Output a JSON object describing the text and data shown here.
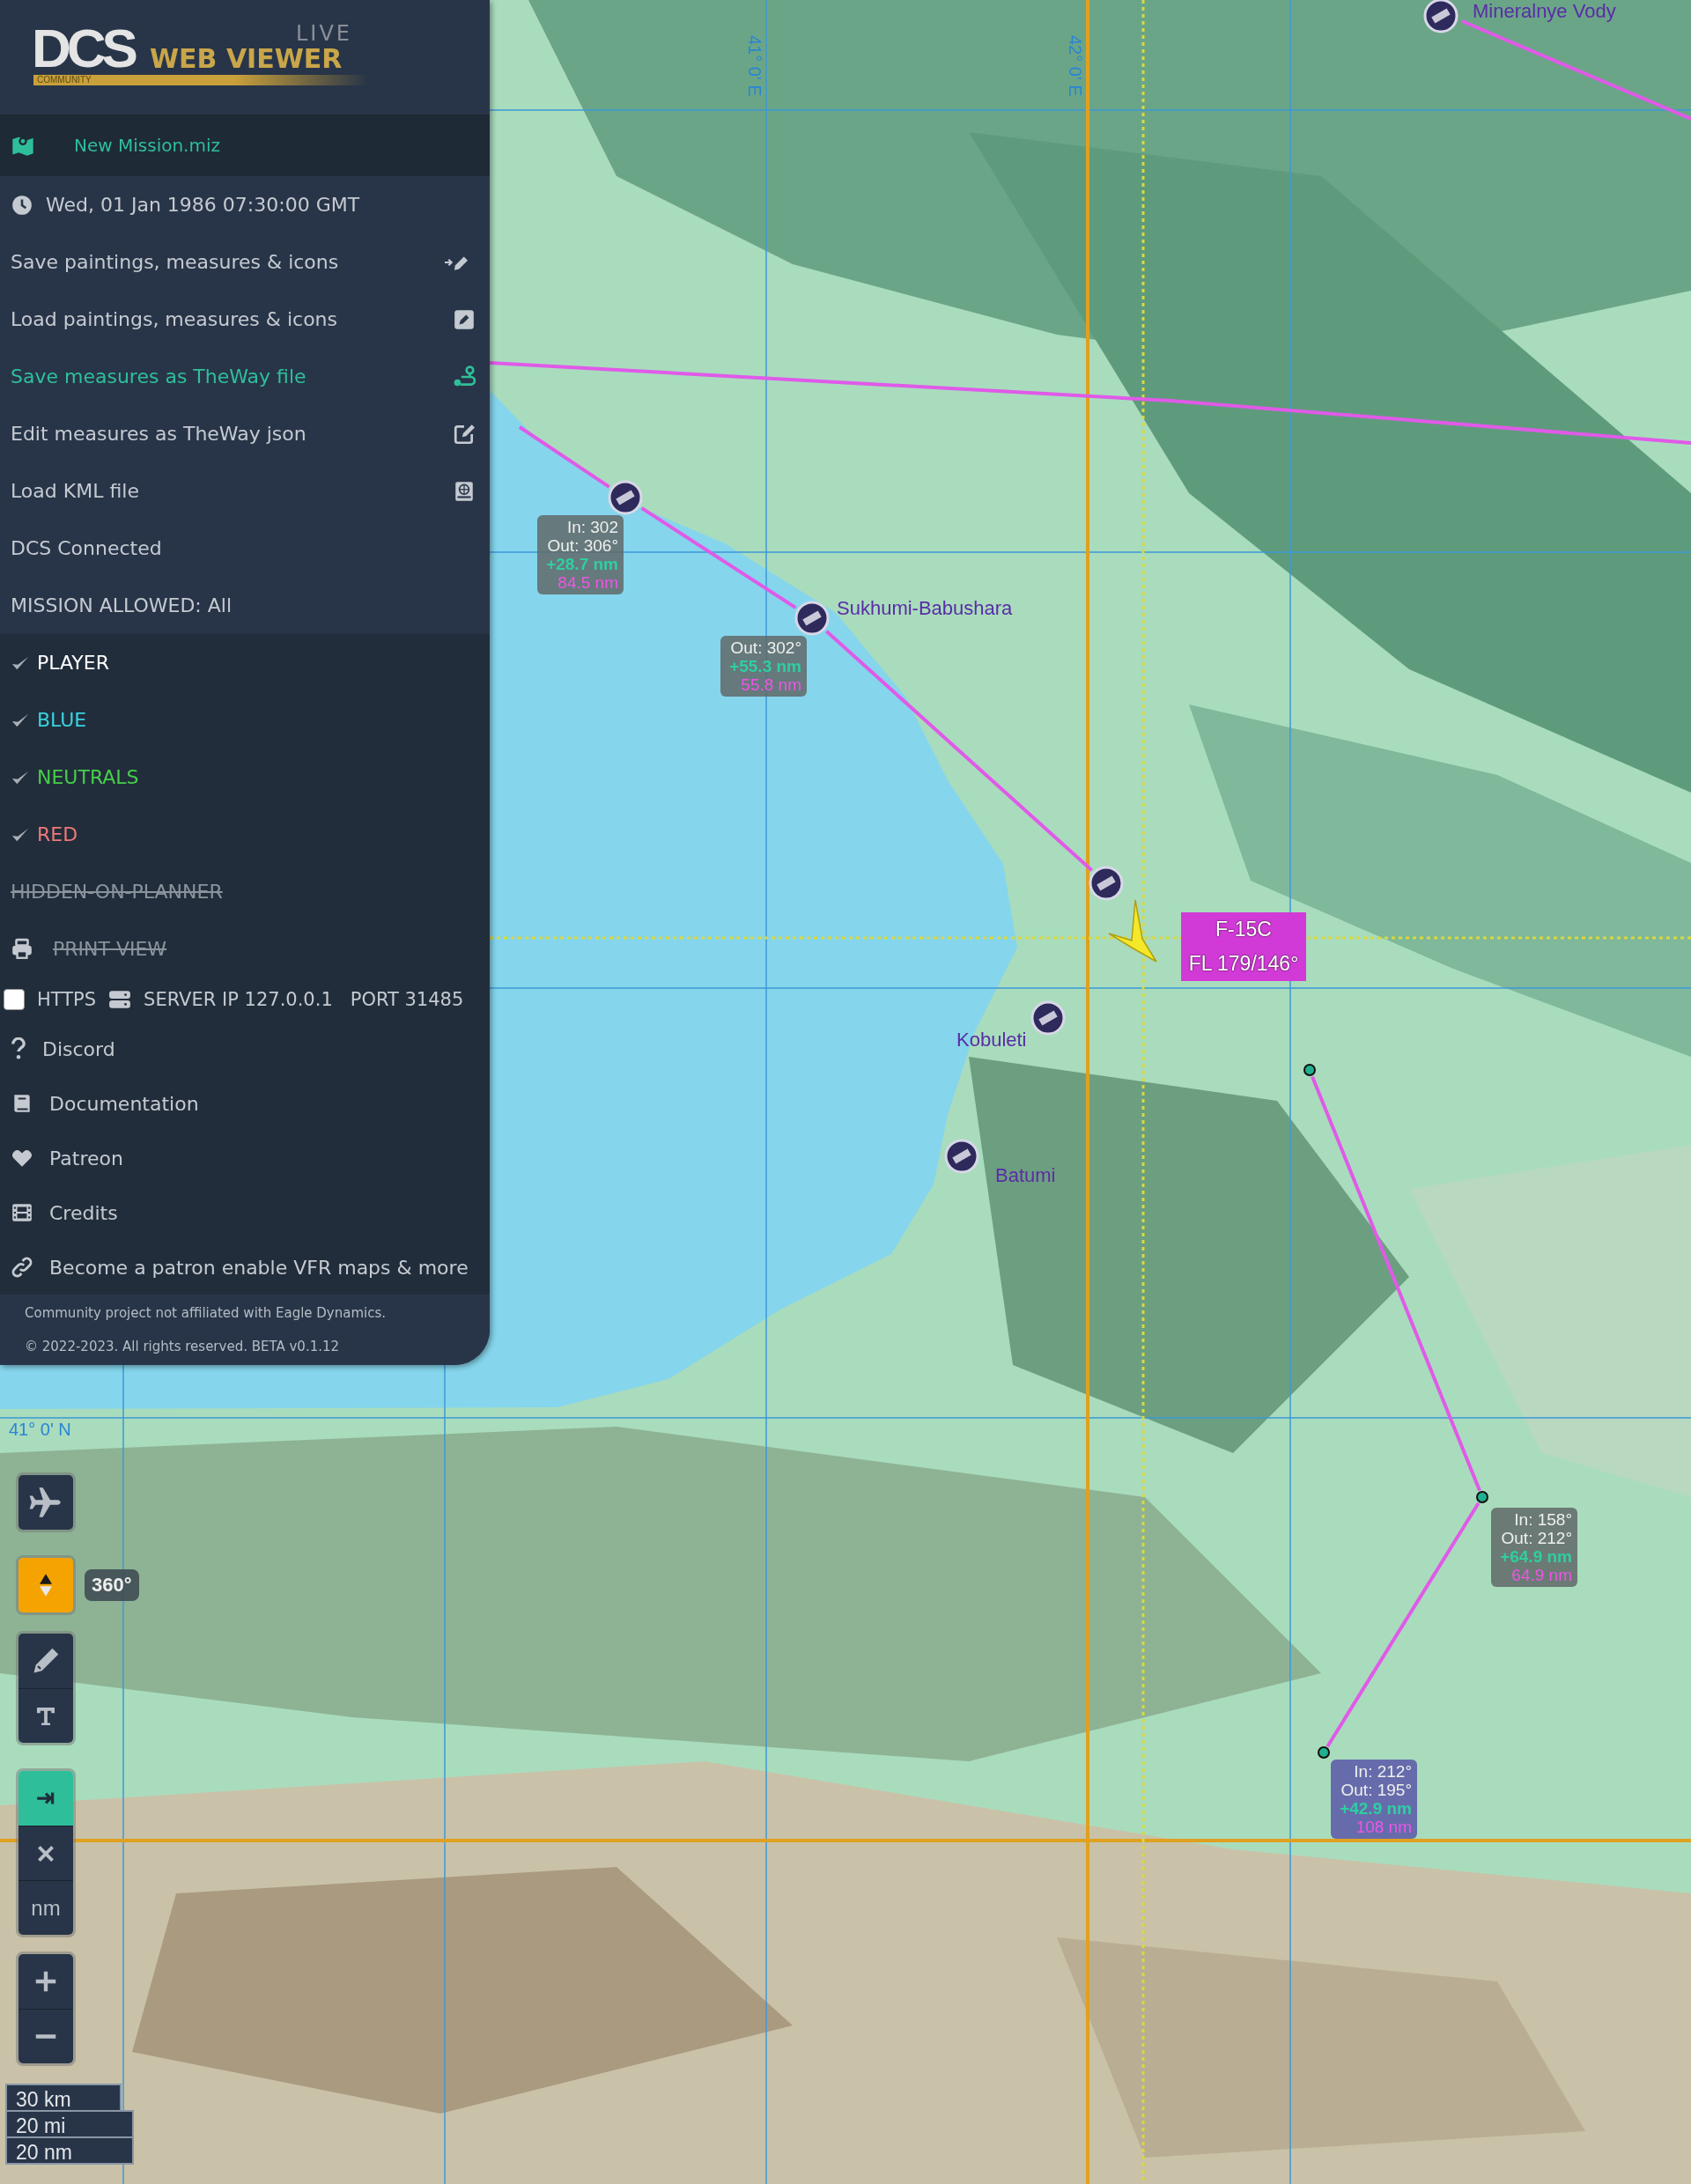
{
  "logo": {
    "title": "DCS",
    "subtitle": "WEB VIEWER",
    "badge": "LIVE",
    "tagline": "COMMUNITY"
  },
  "sidebar": {
    "mission": "New Mission.miz",
    "time": "Wed, 01 Jan 1986 07:30:00 GMT",
    "actions": [
      {
        "label": "Save paintings, measures & icons",
        "selected": false
      },
      {
        "label": "Load paintings, measures & icons",
        "selected": false
      },
      {
        "label": "Save measures as TheWay file",
        "selected": true
      },
      {
        "label": "Edit measures as TheWay json",
        "selected": false
      },
      {
        "label": "Load KML file",
        "selected": false
      }
    ],
    "status": [
      "DCS Connected",
      "MISSION ALLOWED: All"
    ],
    "filters": [
      {
        "label": "PLAYER",
        "checked": true,
        "color": "#ffffff"
      },
      {
        "label": "BLUE",
        "checked": true,
        "color": "#38d3e0"
      },
      {
        "label": "NEUTRALS",
        "checked": true,
        "color": "#45cf4a"
      },
      {
        "label": "RED",
        "checked": true,
        "color": "#ec7a78"
      },
      {
        "label": "HIDDEN-ON-PLANNER",
        "checked": false,
        "color": "#8a939c"
      }
    ],
    "print_view": {
      "label": "PRINT VIEW",
      "on": false
    },
    "connection": {
      "https": {
        "label": "HTTPS",
        "checked": false
      },
      "server": "SERVER IP 127.0.0.1",
      "port": "PORT 31485"
    },
    "links": [
      "Discord",
      "Documentation",
      "Patreon",
      "Credits",
      "Become a patron enable VFR maps & more"
    ],
    "footer": [
      "Community project not affiliated with Eagle Dynamics.",
      "© 2022-2023. All rights reserved. BETA v0.1.12"
    ]
  },
  "map": {
    "grid_labels": [
      "41° 0' E",
      "42° 0' E",
      "41° 0' N"
    ],
    "airbases": [
      "Sukhumi-Babushara",
      "Kobuleti",
      "Batumi",
      "Mineralnye Vody"
    ],
    "waypoints": [
      {
        "in": "In: 302",
        "out": "Out: 306°",
        "leg": "+28.7 nm",
        "total": "84.5 nm",
        "selected": false
      },
      {
        "out": "Out: 302°",
        "leg": "+55.3 nm",
        "total": "55.8 nm",
        "selected": false
      },
      {
        "in": "In: 158°",
        "out": "Out: 212°",
        "leg": "+64.9 nm",
        "total": "64.9 nm",
        "selected": false
      },
      {
        "in": "In: 212°",
        "out": "Out: 195°",
        "leg": "+42.9 nm",
        "total": "108 nm",
        "selected": true
      }
    ],
    "aircraft": {
      "type": "F-15C",
      "flight_level": "FL 179/146°"
    }
  },
  "controls": {
    "heading": "360°",
    "measure_on": true,
    "units": "nm",
    "scale": [
      "30 km",
      "20 mi",
      "20 nm"
    ]
  }
}
